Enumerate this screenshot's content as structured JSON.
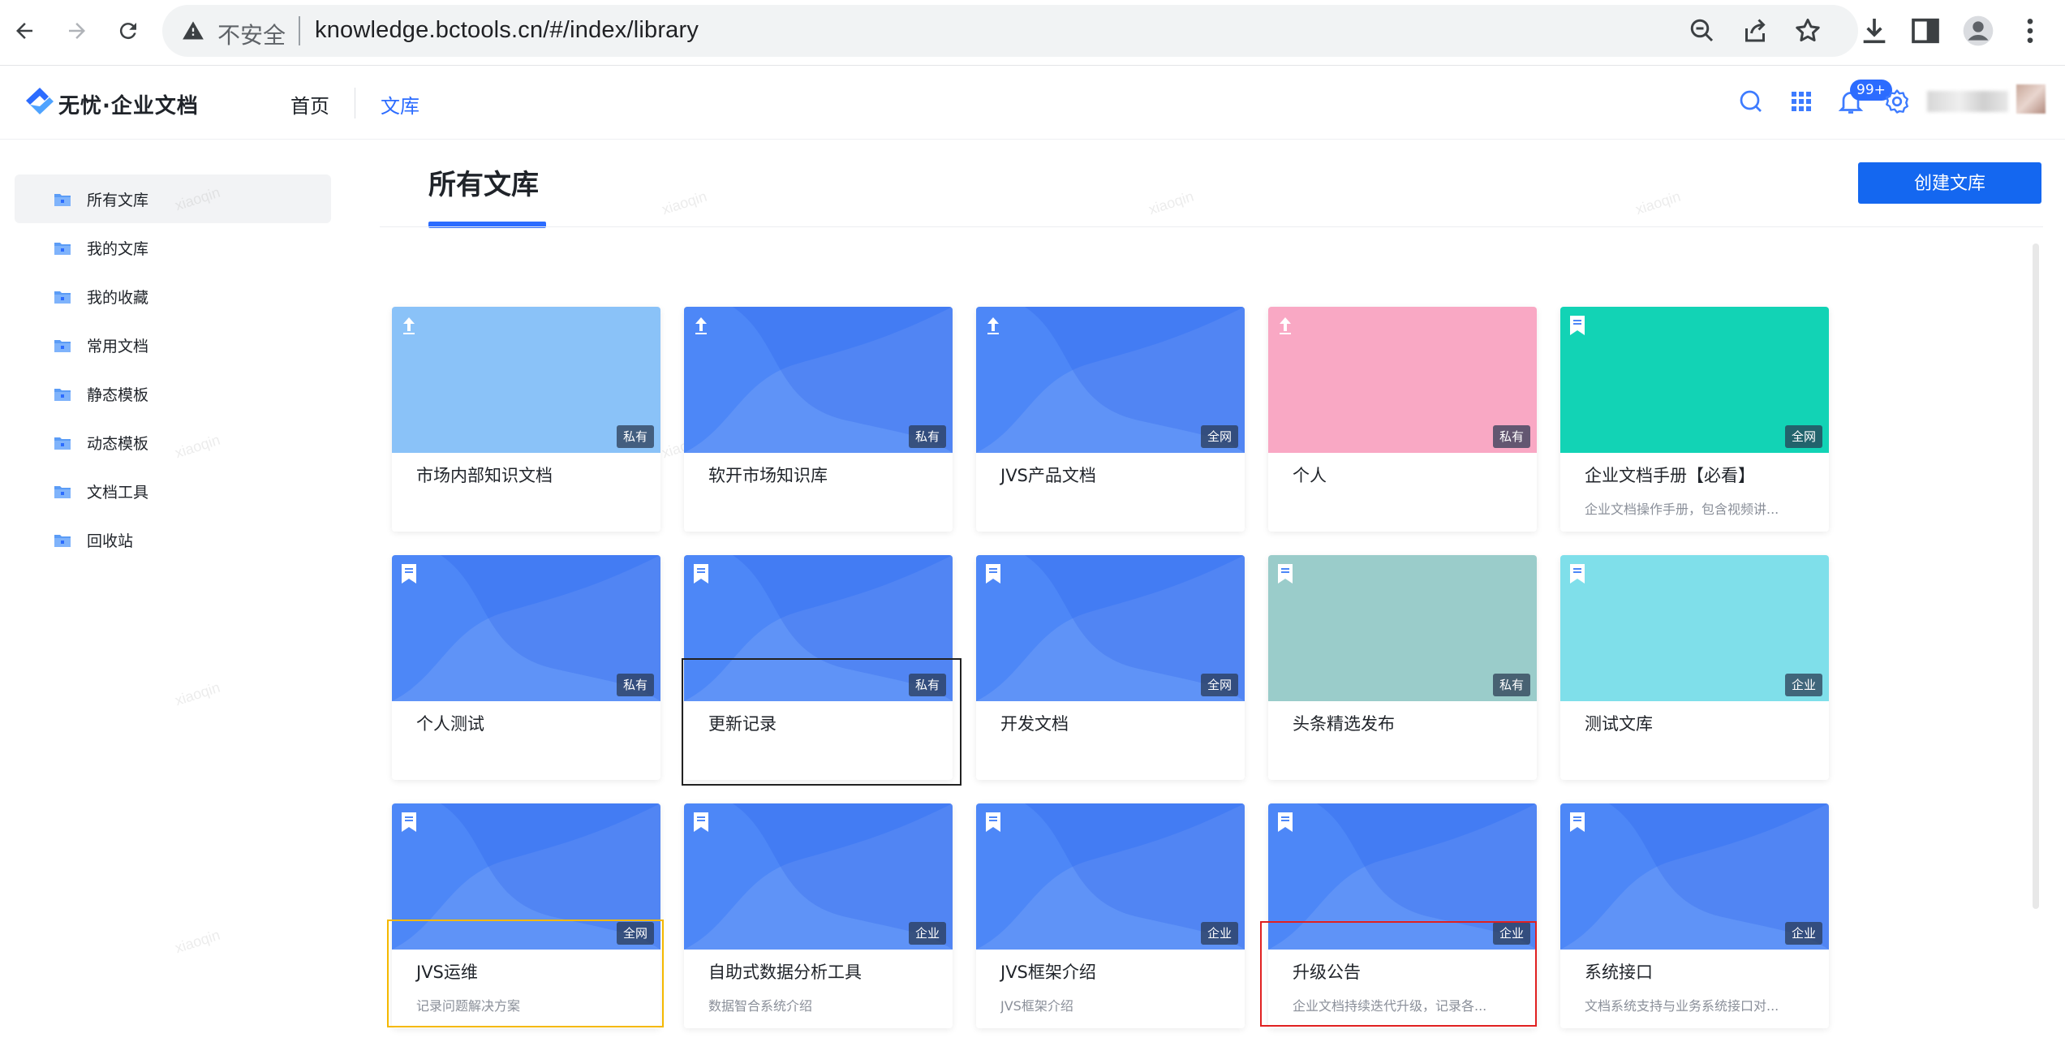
{
  "browser": {
    "insecure_label": "不安全",
    "url": "knowledge.bctools.cn/#/index/library"
  },
  "app": {
    "logo_text": "无忧·企业文档",
    "nav": {
      "home": "首页",
      "library": "文库"
    },
    "notification_count": "99+"
  },
  "sidebar": {
    "items": [
      {
        "label": "所有文库",
        "active": true
      },
      {
        "label": "我的文库"
      },
      {
        "label": "我的收藏"
      },
      {
        "label": "常用文档"
      },
      {
        "label": "静态模板"
      },
      {
        "label": "动态模板"
      },
      {
        "label": "文档工具"
      },
      {
        "label": "回收站"
      }
    ]
  },
  "main": {
    "title": "所有文库",
    "create_button": "创建文库",
    "watermark": "xiaoqin",
    "cards": [
      {
        "title": "市场内部知识文档",
        "desc": "",
        "scope": "私有",
        "color": "#8ac2f8",
        "wave": false,
        "icon": "pin"
      },
      {
        "title": "软开市场知识库",
        "desc": "",
        "scope": "私有",
        "color": "#4d87f7",
        "wave": true,
        "icon": "pin"
      },
      {
        "title": "JVS产品文档",
        "desc": "",
        "scope": "全网",
        "color": "#4d87f7",
        "wave": true,
        "icon": "pin"
      },
      {
        "title": "个人",
        "desc": "",
        "scope": "私有",
        "color": "#f9a8c4",
        "wave": false,
        "icon": "pin"
      },
      {
        "title": "企业文档手册【必看】",
        "desc": "企业文档操作手册，包含视频讲...",
        "scope": "全网",
        "color": "#12d3b5",
        "wave": false,
        "icon": "bookmark"
      },
      {
        "title": "个人测试",
        "desc": "",
        "scope": "私有",
        "color": "#4d87f7",
        "wave": true,
        "icon": "bookmark"
      },
      {
        "title": "更新记录",
        "desc": "",
        "scope": "私有",
        "color": "#4d87f7",
        "wave": true,
        "icon": "bookmark"
      },
      {
        "title": "开发文档",
        "desc": "",
        "scope": "全网",
        "color": "#4d87f7",
        "wave": true,
        "icon": "bookmark"
      },
      {
        "title": "头条精选发布",
        "desc": "",
        "scope": "私有",
        "color": "#9accca",
        "wave": false,
        "icon": "bookmark"
      },
      {
        "title": "测试文库",
        "desc": "",
        "scope": "企业",
        "color": "#7fdfea",
        "wave": false,
        "icon": "bookmark"
      },
      {
        "title": "JVS运维",
        "desc": "记录问题解决方案",
        "scope": "全网",
        "color": "#4d87f7",
        "wave": true,
        "icon": "bookmark"
      },
      {
        "title": "自助式数据分析工具",
        "desc": "数据智合系统介绍",
        "scope": "企业",
        "color": "#4d87f7",
        "wave": true,
        "icon": "bookmark"
      },
      {
        "title": "JVS框架介绍",
        "desc": "JVS框架介绍",
        "scope": "企业",
        "color": "#4d87f7",
        "wave": true,
        "icon": "bookmark"
      },
      {
        "title": "升级公告",
        "desc": "企业文档持续迭代升级，记录各...",
        "scope": "企业",
        "color": "#4d87f7",
        "wave": true,
        "icon": "bookmark"
      },
      {
        "title": "系统接口",
        "desc": "文档系统支持与业务系统接口对...",
        "scope": "企业",
        "color": "#4d87f7",
        "wave": true,
        "icon": "bookmark"
      }
    ]
  },
  "highlight_colors": {
    "black": "#222222",
    "yellow": "#f5b800",
    "red": "#e02020"
  }
}
